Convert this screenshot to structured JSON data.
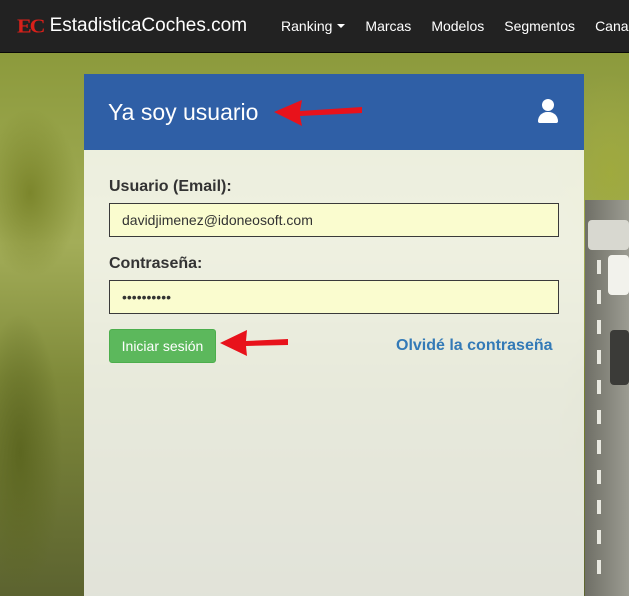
{
  "navbar": {
    "logo_text": "EC",
    "brand": "EstadisticaCoches.com",
    "items": [
      {
        "label": "Ranking",
        "dropdown": true
      },
      {
        "label": "Marcas"
      },
      {
        "label": "Modelos"
      },
      {
        "label": "Segmentos"
      },
      {
        "label": "Canales"
      }
    ]
  },
  "login": {
    "title": "Ya soy usuario",
    "icon": "user-icon",
    "email_label": "Usuario (Email):",
    "email_value": "davidjimenez@idoneosoft.com",
    "password_label": "Contraseña:",
    "password_value": "••••••••••",
    "submit_label": "Iniciar sesión",
    "forgot_label": "Olvidé la contraseña"
  },
  "colors": {
    "navbar_bg": "#222222",
    "logo_red": "#d9201a",
    "panel_header": "#2f5fa6",
    "input_bg": "#fafccf",
    "button_green": "#5cb85c",
    "link_blue": "#337ab7",
    "annotation_arrow": "#e8121b"
  }
}
